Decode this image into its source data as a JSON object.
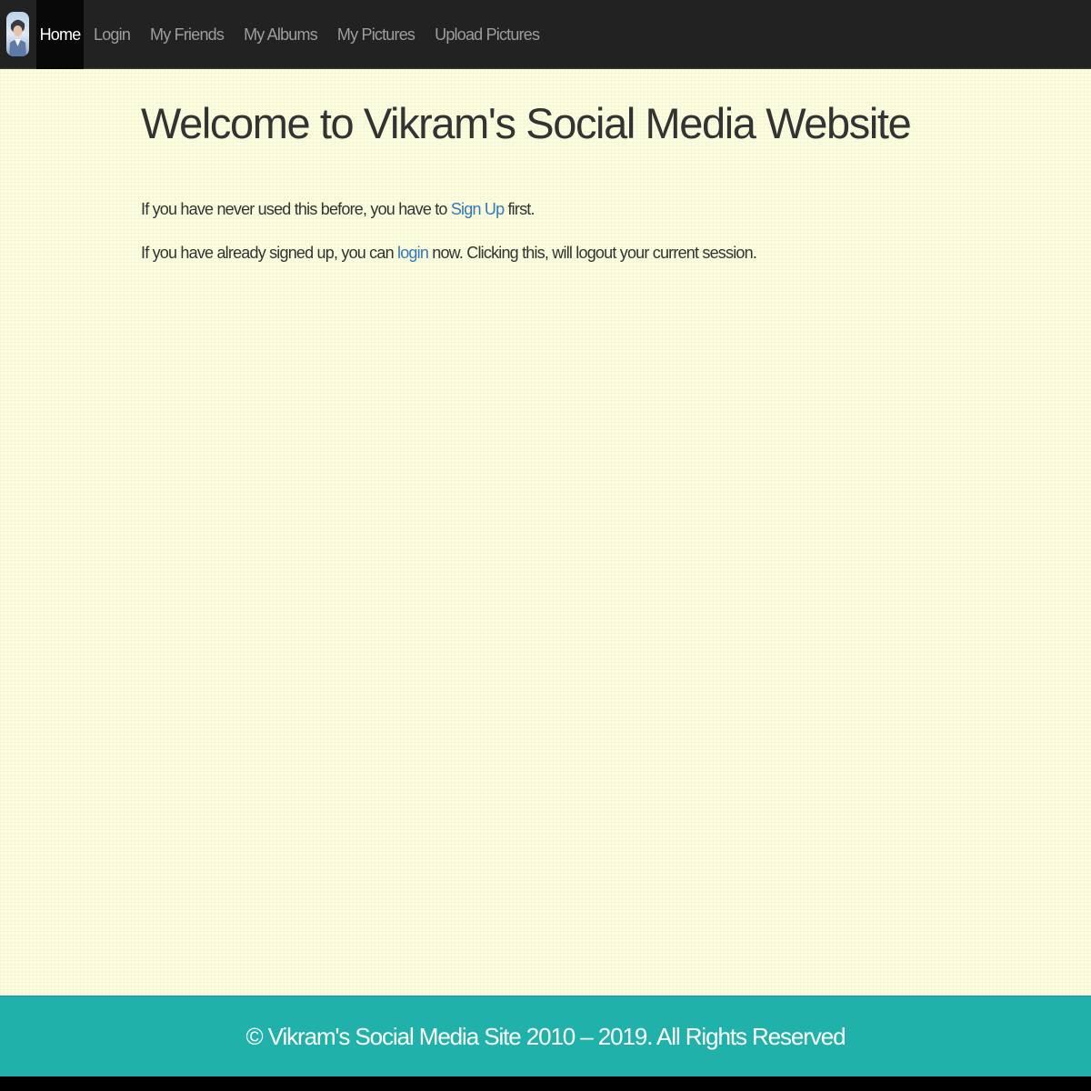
{
  "navbar": {
    "brand_icon": "user-avatar-icon",
    "items": [
      {
        "label": "Home",
        "active": true
      },
      {
        "label": "Login"
      },
      {
        "label": "My Friends"
      },
      {
        "label": "My Albums"
      },
      {
        "label": "My Pictures"
      },
      {
        "label": "Upload Pictures"
      }
    ]
  },
  "main": {
    "title": "Welcome to Vikram's Social Media Website",
    "paragraph1": {
      "before": "If you have never used this before, you have to ",
      "link": "Sign Up",
      "after": " first."
    },
    "paragraph2": {
      "before": "If you have already signed up, you can ",
      "link": "login",
      "after": " now. Clicking this, will logout your current session."
    }
  },
  "footer": {
    "text": "© Vikram's Social Media Site 2010 – 2019. All Rights Reserved"
  },
  "colors": {
    "navbar_bg": "#222222",
    "active_nav_bg": "#080808",
    "page_bg": "#fdfde0",
    "link": "#337ab7",
    "footer_bg": "#20b2aa"
  }
}
